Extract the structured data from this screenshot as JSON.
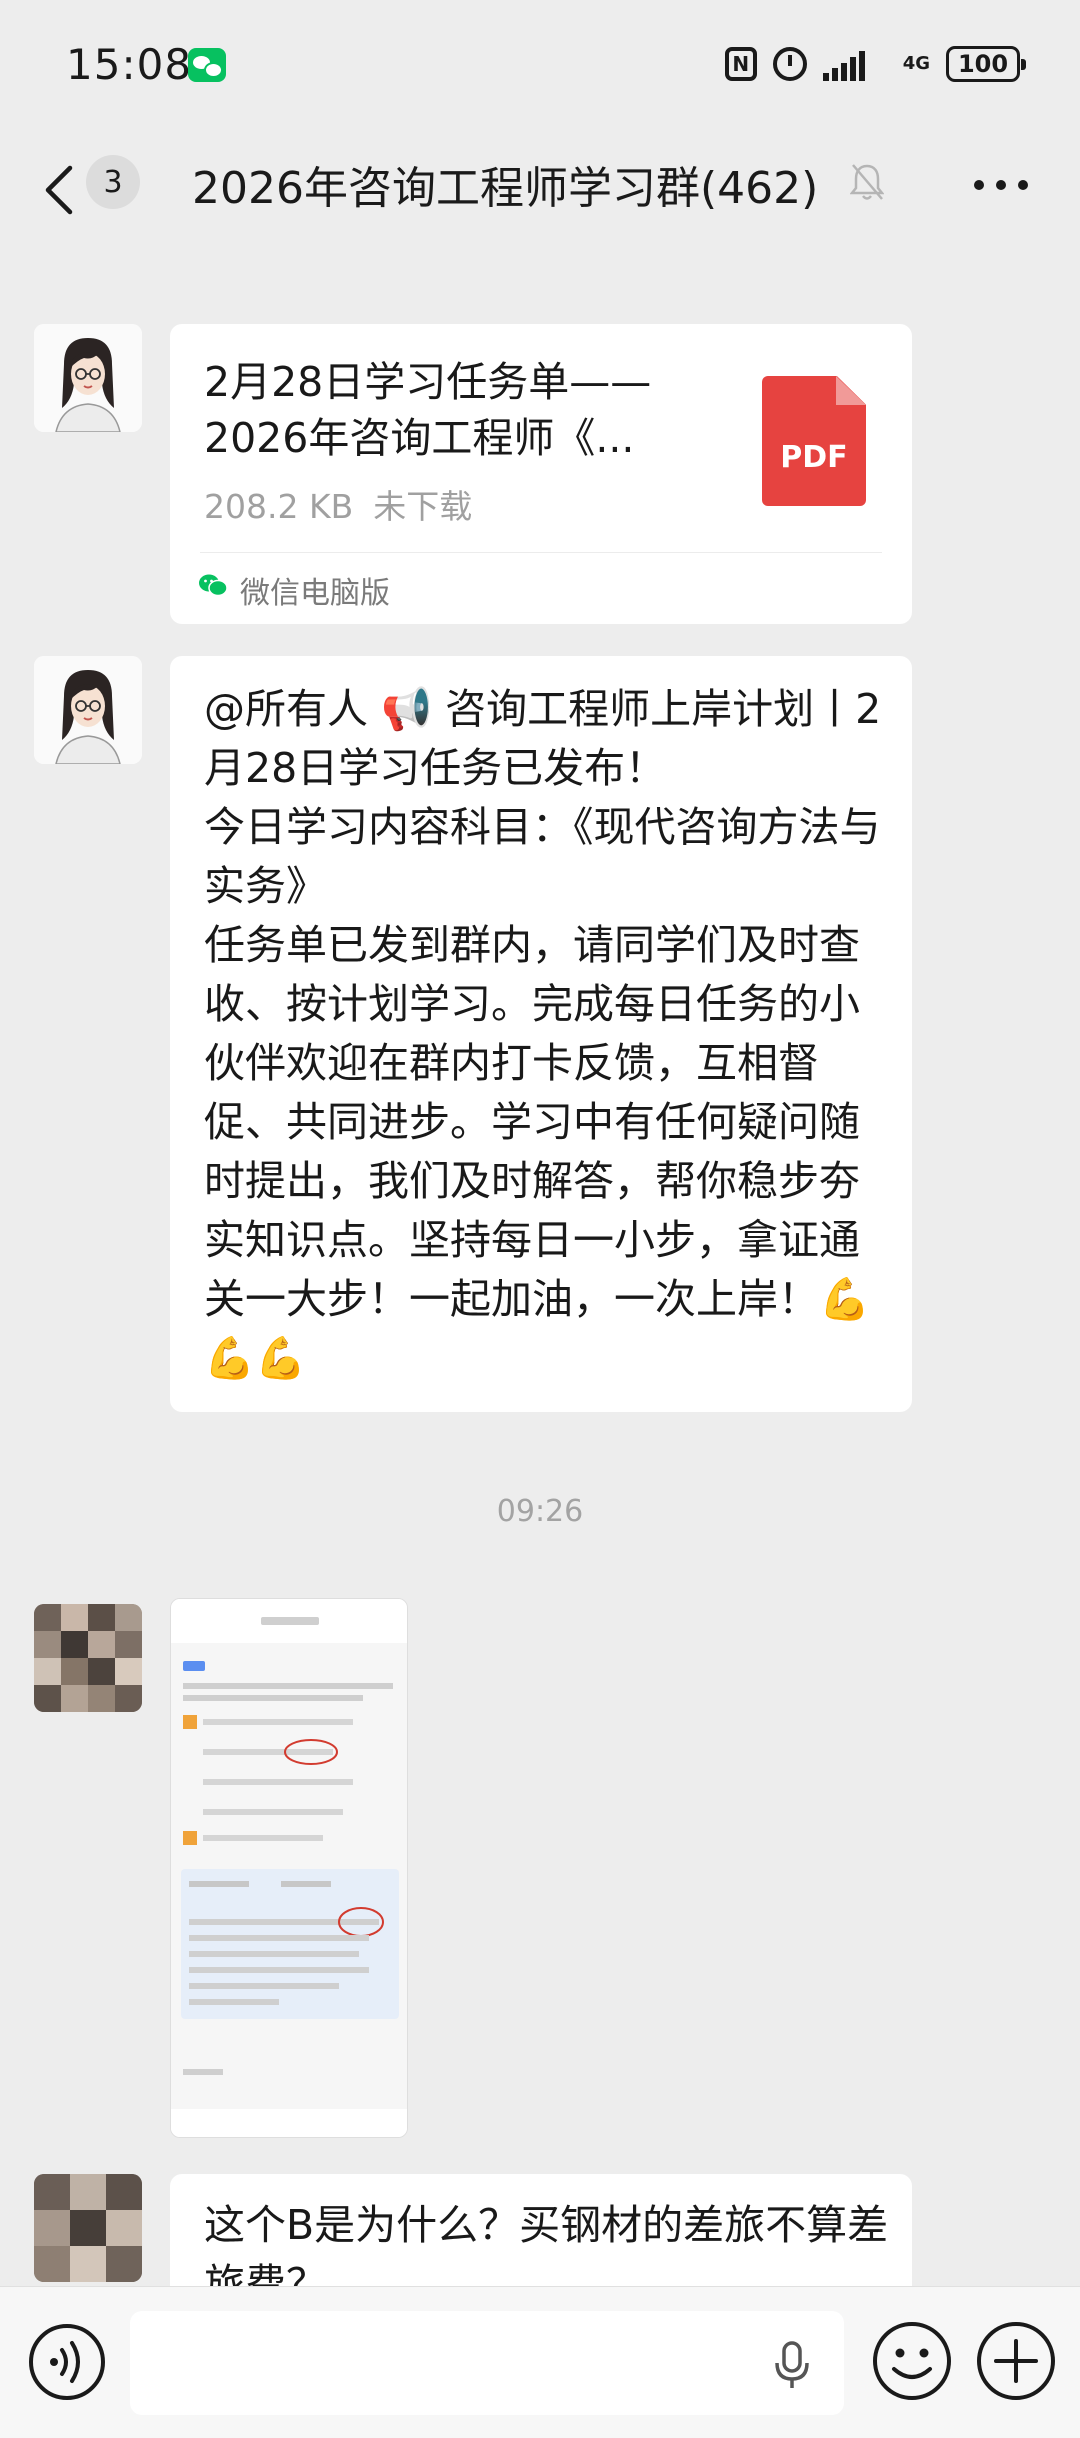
{
  "status_bar": {
    "time": "15:08",
    "network": "4G",
    "battery": "100",
    "icons": [
      "wechat-icon",
      "nfc-icon",
      "alarm-icon",
      "signal-icon",
      "battery-icon"
    ]
  },
  "header": {
    "unread_count": "3",
    "title": "2026年咨询工程师学习群(462)",
    "icons": [
      "back-icon",
      "mute-bell-icon",
      "more-icon"
    ]
  },
  "messages": {
    "file_card": {
      "title_line1": "2月28日学习任务单——",
      "title_line2": "2026年咨询工程师《...",
      "size": "208.2 KB",
      "status": "未下载",
      "file_type": "PDF",
      "source": "微信电脑版"
    },
    "announcement": {
      "text": "@所有人 📢 咨询工程师上岸计划丨2月28日学习任务已发布！\n今日学习内容科目：《现代咨询方法与实务》\n任务单已发到群内，请同学们及时查收、按计划学习。完成每日任务的小伙伴欢迎在群内打卡反馈，互相督促、共同进步。学习中有任何疑问随时提出，我们及时解答，帮你稳步夯实知识点。坚持每日一小步，拿证通关一大步！一起加油，一次上岸！💪💪💪"
    },
    "timestamp": "09:26",
    "question": {
      "text": "这个B是为什么？买钢材的差旅不算差旅费？"
    }
  },
  "input_bar": {
    "icons": [
      "voice-toggle-icon",
      "microphone-icon",
      "emoji-icon",
      "plus-icon"
    ]
  },
  "colors": {
    "background": "#ededed",
    "bubble": "#ffffff",
    "pdf_red": "#e64340",
    "wechat_green": "#07c160",
    "muted_text": "#a0a0a0"
  }
}
